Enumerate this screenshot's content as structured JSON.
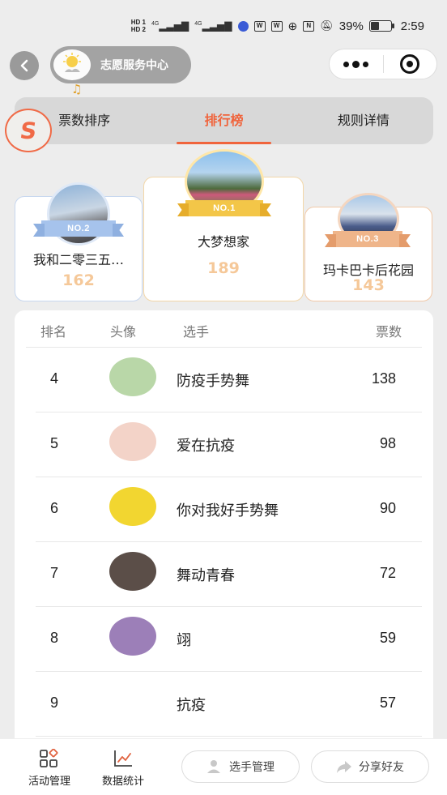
{
  "status_bar": {
    "sim1": "HD 1",
    "sim2": "HD 2",
    "net1": "4G",
    "net2": "4G",
    "battery": "39%",
    "battery_level": 0.39,
    "time": "2:59"
  },
  "nav": {
    "title": "志愿服务中心",
    "note_glyph": "♫",
    "badge_glyph": "S"
  },
  "tabs": [
    {
      "label": "票数排序",
      "active": false
    },
    {
      "label": "排行榜",
      "active": true
    },
    {
      "label": "规则详情",
      "active": false
    }
  ],
  "podium": [
    {
      "rank_label": "NO.2",
      "name": "我和二零三五…",
      "votes": "162"
    },
    {
      "rank_label": "NO.1",
      "name": "大梦想家",
      "votes": "189"
    },
    {
      "rank_label": "NO.3",
      "name": "玛卡巴卡后花园",
      "votes": "143"
    }
  ],
  "table": {
    "headers": {
      "rank": "排名",
      "avatar": "头像",
      "player": "选手",
      "votes": "票数"
    },
    "rows": [
      {
        "rank": "4",
        "name": "防疫手势舞",
        "votes": "138",
        "avatar_color": "#b9d7a8"
      },
      {
        "rank": "5",
        "name": "爱在抗疫",
        "votes": "98",
        "avatar_color": "#f3d3c8"
      },
      {
        "rank": "6",
        "name": "你对我好手势舞",
        "votes": "90",
        "avatar_color": "#f2d630"
      },
      {
        "rank": "7",
        "name": "舞动青春",
        "votes": "72",
        "avatar_color": "#5b4e48"
      },
      {
        "rank": "8",
        "name": "翊",
        "votes": "59",
        "avatar_color": "#9c7fb8"
      },
      {
        "rank": "9",
        "name": "抗疫",
        "votes": "57",
        "avatar_color": ""
      }
    ]
  },
  "bottom_bar": {
    "activity": "活动管理",
    "stats": "数据统计",
    "player_mgmt": "选手管理",
    "share": "分享好友"
  },
  "colors": {
    "accent": "#f0643c",
    "score": "#f5c899",
    "gold": "#f3c648",
    "silver": "#a6c3ec",
    "bronze": "#efb58a"
  }
}
